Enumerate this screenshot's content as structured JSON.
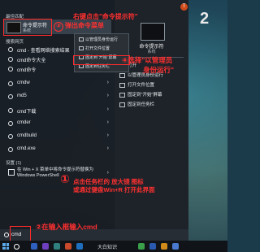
{
  "menu": {
    "best_match_header": "最佳匹配",
    "best_match": {
      "title": "命令提示符",
      "subtitle": "系统"
    },
    "web_header": "搜索网页",
    "rows": [
      {
        "label": "cmd - 查看网络搜索结果"
      },
      {
        "label": "cmd命令大全"
      },
      {
        "label": "cmd命令"
      },
      {
        "label": "cmdw"
      },
      {
        "label": "md5"
      },
      {
        "label": "cmd下载"
      },
      {
        "label": "cmder"
      },
      {
        "label": "cmdbuild"
      },
      {
        "label": "cmd.exe"
      }
    ],
    "settings_header": "设置 (1)",
    "settings_text": "在 Win + X 菜单中将命令提示符替换为 Windows PowerShell"
  },
  "right_panel": {
    "title": "命令提示符",
    "subtitle": "系统",
    "items": [
      {
        "label": "打开"
      },
      {
        "label": "以管理员身份运行"
      },
      {
        "label": "打开文件位置"
      },
      {
        "label": "固定到\"开始\"屏幕"
      },
      {
        "label": "固定到任务栏"
      }
    ]
  },
  "context_menu": {
    "items": [
      {
        "label": "以管理员身份运行"
      },
      {
        "label": "打开文件位置"
      },
      {
        "label": "固定到\"开始\"屏幕"
      },
      {
        "label": "固定到任务栏"
      }
    ]
  },
  "annotations": {
    "step3_line1": "右键点击\"命令提示符\"",
    "step3_line2": "弹出命令菜单",
    "step3_num": "③",
    "step4_line1": "选择\"以管理员",
    "step4_line2": "身份运行\"",
    "step4_num": "④",
    "step1_line1": "点击任务栏的 放大镜 图标",
    "step1_line2": "或通过键盘Win+R 打开此界面",
    "step1_num": "①",
    "step2_text": "在输入框输入cmd",
    "step2_num": "②",
    "big_two": "2"
  },
  "search": {
    "value": "cmd"
  },
  "taskbar": {
    "label": "大白知识"
  },
  "user": {
    "avatar_letter": "T"
  },
  "colors": {
    "accent": "#ff3030"
  }
}
